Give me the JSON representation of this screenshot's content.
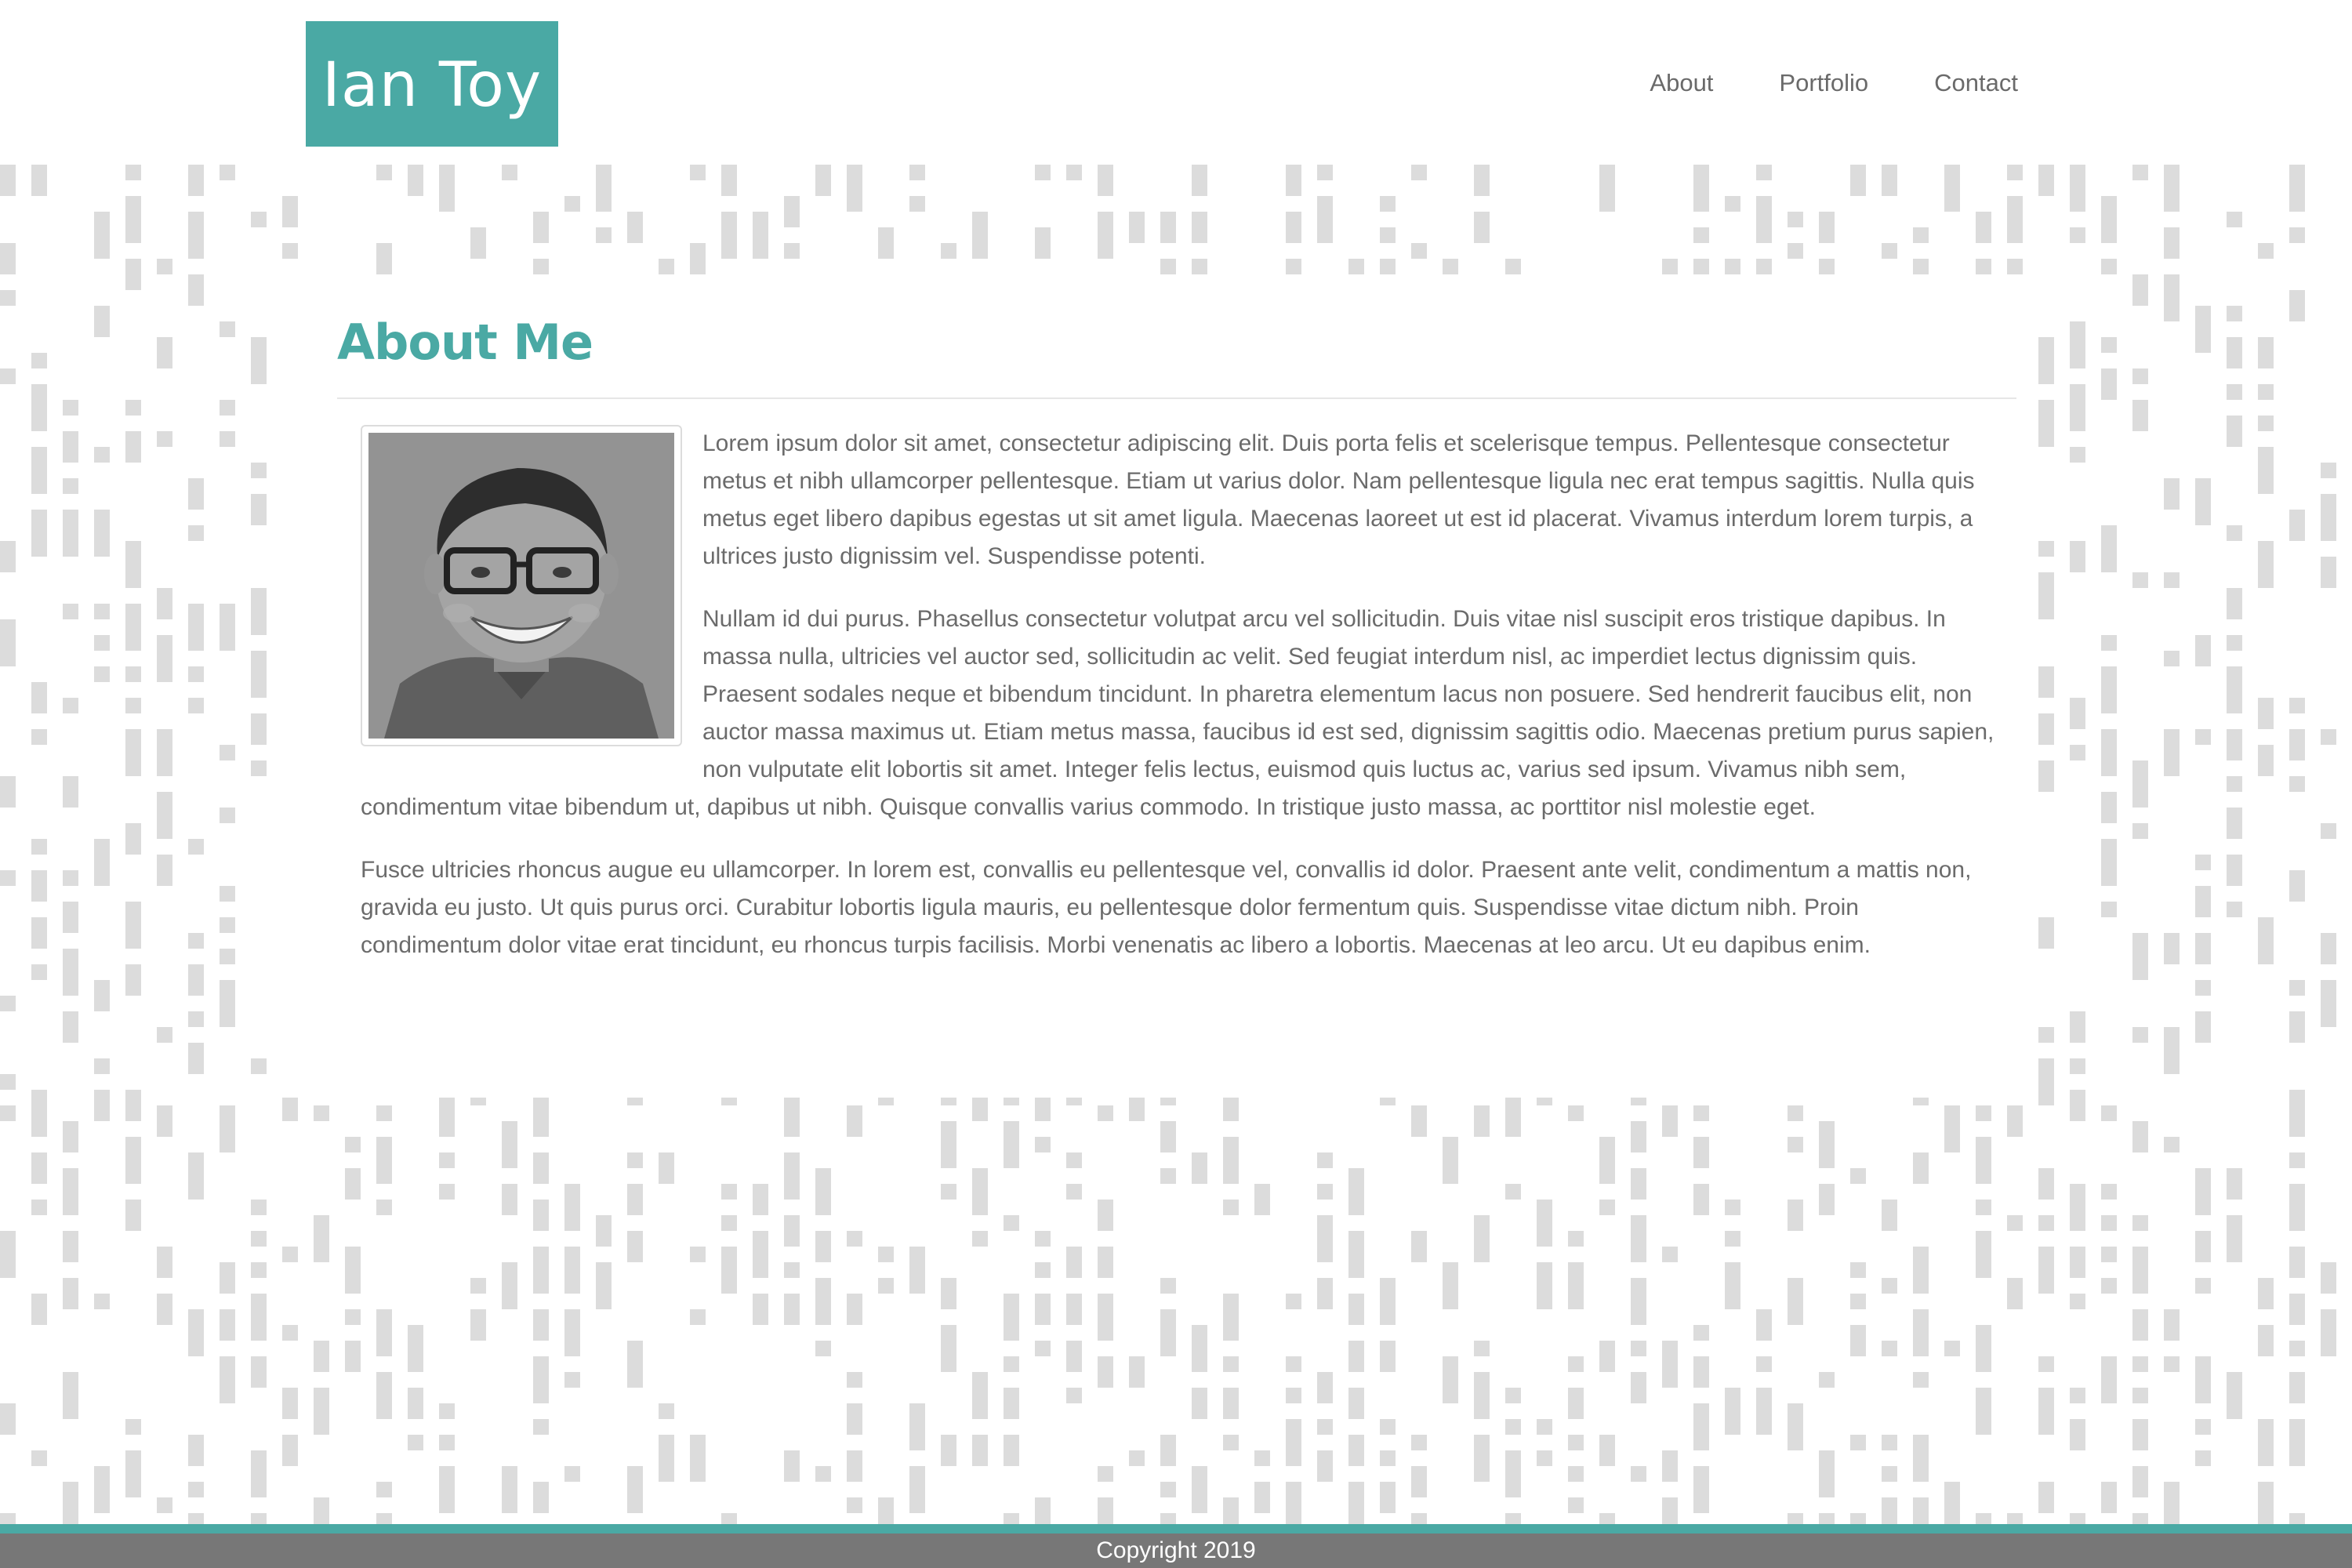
{
  "header": {
    "brand": "Ian Toy",
    "nav": [
      "About",
      "Portfolio",
      "Contact"
    ]
  },
  "about": {
    "title": "About Me",
    "paragraphs": [
      "Lorem ipsum dolor sit amet, consectetur adipiscing elit. Duis porta felis et scelerisque tempus. Pellentesque consectetur metus et nibh ullamcorper pellentesque. Etiam ut varius dolor. Nam pellentesque ligula nec erat tempus sagittis. Nulla quis metus eget libero dapibus egestas ut sit amet ligula. Maecenas laoreet ut est id placerat. Vivamus interdum lorem turpis, a ultrices justo dignissim vel. Suspendisse potenti.",
      "Nullam id dui purus. Phasellus consectetur volutpat arcu vel sollicitudin. Duis vitae nisl suscipit eros tristique dapibus. In massa nulla, ultricies vel auctor sed, sollicitudin ac velit. Sed feugiat interdum nisl, ac imperdiet lectus dignissim quis. Praesent sodales neque et bibendum tincidunt. In pharetra elementum lacus non posuere. Sed hendrerit faucibus elit, non auctor massa maximus ut. Etiam metus massa, faucibus id est sed, dignissim sagittis odio. Maecenas pretium purus sapien, non vulputate elit lobortis sit amet. Integer felis lectus, euismod quis luctus ac, varius sed ipsum. Vivamus nibh sem, condimentum vitae bibendum ut, dapibus ut nibh. Quisque convallis varius commodo. In tristique justo massa, ac porttitor nisl molestie eget.",
      "Fusce ultricies rhoncus augue eu ullamcorper. In lorem est, convallis eu pellentesque vel, convallis id dolor. Praesent ante velit, condimentum a mattis non, gravida eu justo. Ut quis purus orci. Curabitur lobortis ligula mauris, eu pellentesque dolor fermentum quis. Suspendisse vitae dictum nibh. Proin condimentum dolor vitae erat tincidunt, eu rhoncus turpis facilisis. Morbi venenatis ac libero a lobortis. Maecenas at leo arcu. Ut eu dapibus enim."
    ]
  },
  "footer": {
    "copyright": "Copyright 2019"
  },
  "colors": {
    "accent": "#4aa9a4",
    "pattern": "#dcdcdc",
    "footer": "#777777"
  },
  "icons": {
    "profile_photo": "profile-photo"
  }
}
